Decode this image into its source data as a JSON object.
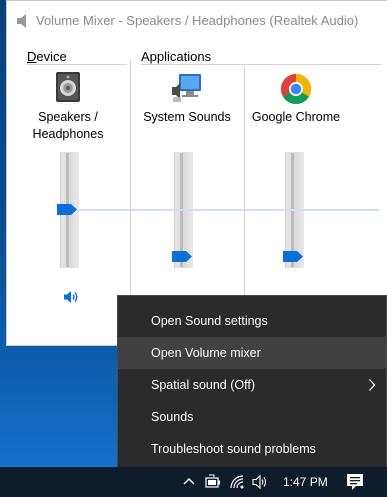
{
  "window": {
    "title": "Volume Mixer - Speakers / Headphones (Realtek Audio)"
  },
  "sections": {
    "device_label": "Device",
    "device_underline": "D",
    "device_rest": "evice",
    "applications_label": "Applications"
  },
  "channels": [
    {
      "name_line1": "Speakers /",
      "name_line2": "Headphones",
      "icon": "speaker-device-icon",
      "level": 0.52,
      "muted": false
    },
    {
      "name_line1": "System Sounds",
      "name_line2": "",
      "icon": "system-sounds-icon",
      "level": 0.12,
      "muted": false
    },
    {
      "name_line1": "Google Chrome",
      "name_line2": "",
      "icon": "chrome-icon",
      "level": 0.12,
      "muted": false
    }
  ],
  "context_menu": {
    "items": [
      {
        "label": "Open Sound settings",
        "highlighted": false,
        "submenu": false
      },
      {
        "label": "Open Volume mixer",
        "highlighted": true,
        "submenu": false
      },
      {
        "label": "Spatial sound (Off)",
        "highlighted": false,
        "submenu": true
      },
      {
        "label": "Sounds",
        "highlighted": false,
        "submenu": false
      },
      {
        "label": "Troubleshoot sound problems",
        "highlighted": false,
        "submenu": false
      }
    ]
  },
  "taskbar": {
    "time": "1:47 PM",
    "tray_icons": [
      "chevron-up-icon",
      "battery-icon",
      "wifi-icon",
      "volume-icon",
      "notification-icon"
    ]
  },
  "colors": {
    "accent": "#0a6fd6",
    "menu_bg": "#2b2b2b",
    "menu_highlight": "#414141",
    "taskbar_bg": "#0f1c2b"
  }
}
